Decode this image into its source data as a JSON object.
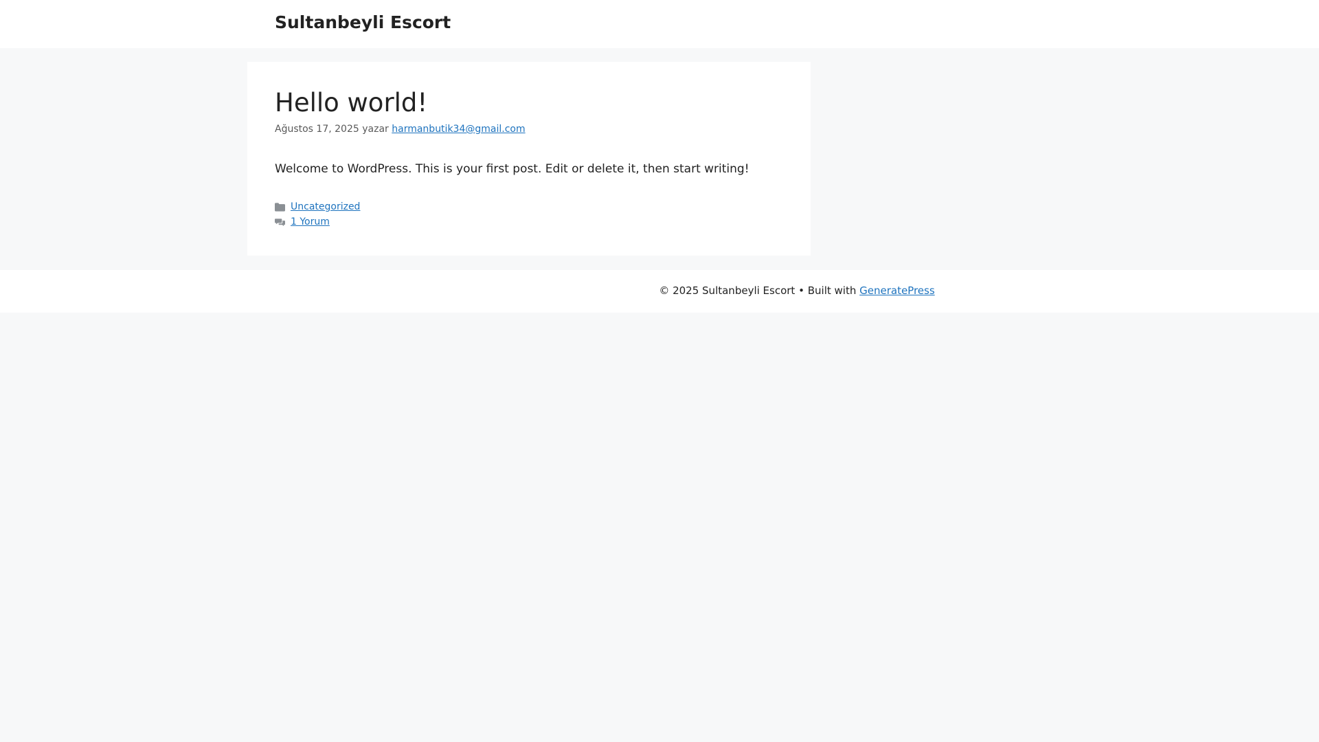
{
  "header": {
    "site_title": "Sultanbeyli Escort"
  },
  "post": {
    "title": "Hello world!",
    "date": "Ağustos 17, 2025",
    "by_label": "yazar",
    "author": "harmanbutik34@gmail.com",
    "content": "Welcome to WordPress. This is your first post. Edit or delete it, then start writing!",
    "category": "Uncategorized",
    "comments": "1 Yorum"
  },
  "footer": {
    "copyright": "© 2025 Sultanbeyli Escort",
    "separator": "•",
    "built_with": "Built with",
    "theme_link": "GeneratePress"
  },
  "icons": {
    "category": "folder-icon",
    "comments": "comments-icon"
  },
  "colors": {
    "link": "#1e73be",
    "background": "#f7f8f9",
    "text": "#222222",
    "meta": "#595959"
  }
}
